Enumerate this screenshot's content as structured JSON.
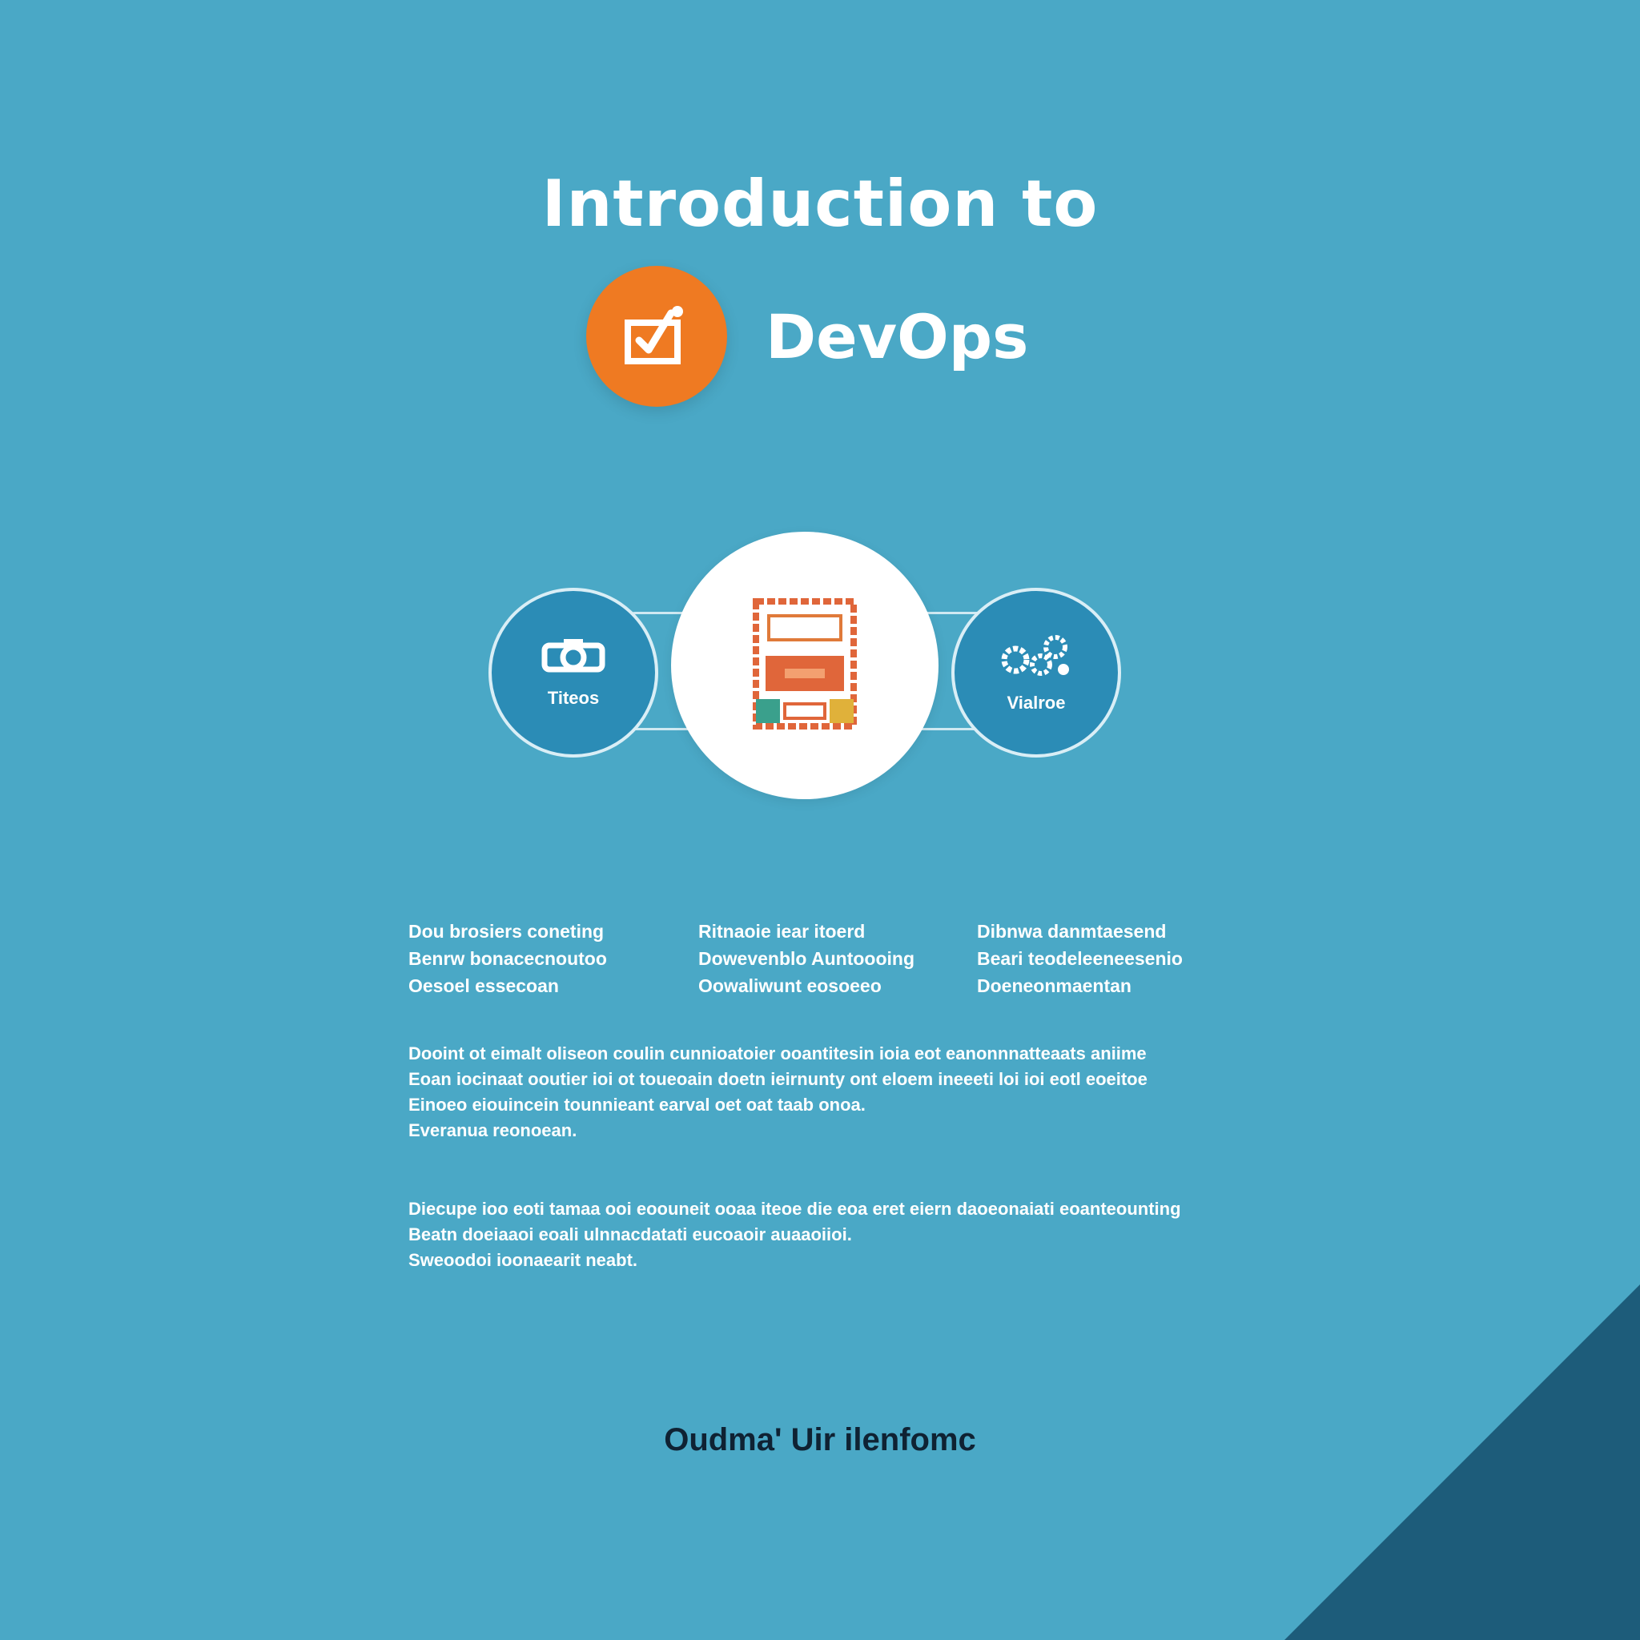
{
  "header": {
    "title_line1": "Introduction to",
    "brand_name": "DevOps",
    "brand_icon": "checkbox-icon",
    "brand_color": "#ef7a22"
  },
  "diagram": {
    "left_node": {
      "label": "Titeos",
      "icon": "gear-camera-icon"
    },
    "center_node": {
      "icon": "server-board-icon"
    },
    "right_node": {
      "label": "Vialroe",
      "icon": "gears-cluster-icon"
    }
  },
  "columns": [
    {
      "lines": [
        "Dou brosiers coneting",
        "Benrw bonacecnoutoo",
        "Oesoel essecoan"
      ]
    },
    {
      "lines": [
        "Ritnaoie iear itoerd",
        "Dowevenblo Auntoooing",
        "Oowaliwunt eosoeeo"
      ]
    },
    {
      "lines": [
        "Dibnwa danmtaesend",
        "Beari teodeleeneesenio",
        "Doeneonmaentan"
      ]
    }
  ],
  "paragraphs": [
    {
      "lines": [
        "Dooint ot eimalt oliseon coulin cunnioatoier ooantitesin ioia eot eanonnnatteaats aniime",
        "Eoan iocinaat ooutier ioi ot toueoain doetn ieirnunty ont eloem ineeeti loi ioi eotl eoeitoe",
        "Einoeo eiouincein tounnieant earval oet oat taab onoa.",
        "Everanua reonoean."
      ]
    },
    {
      "lines": [
        "Diecupe ioo eoti tamaa ooi eoouneit ooaa iteoe die eoa eret eiern daoeonaiati eoanteounting",
        "Beatn doeiaaoi eoali ulnnacdatati eucoaoir auaaoiioi.",
        "Sweoodoi ioonaearit neabt."
      ]
    }
  ],
  "footer": {
    "text": "Oudma' Uir ilenfomc"
  },
  "colors": {
    "background": "#4aa8c6",
    "corner": "#1d5c7a",
    "node_fill": "#2b8cb6"
  }
}
